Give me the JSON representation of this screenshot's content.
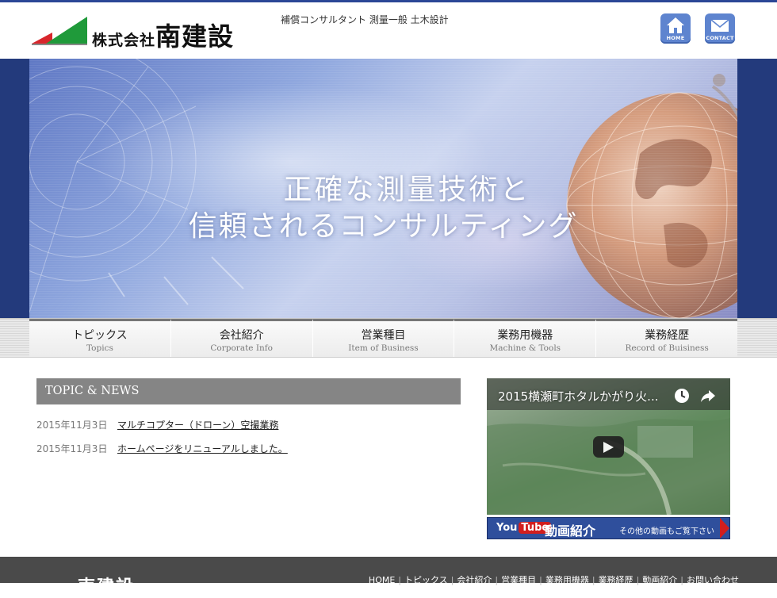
{
  "header": {
    "logo_small": "株式会社",
    "logo_big": "南建設",
    "tagline": "補償コンサルタント 測量一般 土木設計",
    "home_label": "HOME",
    "contact_label": "CONTACT"
  },
  "hero": {
    "line1": "正確な測量技術と",
    "line2": "信頼されるコンサルティング"
  },
  "nav": [
    {
      "jp": "トピックス",
      "en": "Topics"
    },
    {
      "jp": "会社紹介",
      "en": "Corporate Info"
    },
    {
      "jp": "営業種目",
      "en": "Item of Business"
    },
    {
      "jp": "業務用機器",
      "en": "Machine & Tools"
    },
    {
      "jp": "業務経歴",
      "en": "Record of Buisiness"
    }
  ],
  "topics": {
    "heading": "TOPIC & NEWS",
    "items": [
      {
        "date": "2015年11月3日",
        "title": "マルチコプター（ドローン）空撮業務"
      },
      {
        "date": "2015年11月3日",
        "title": "ホームページをリニューアルしました。"
      }
    ]
  },
  "video": {
    "title": "2015横瀬町ホタルかがり火...",
    "yt_you": "You",
    "yt_tube": "Tube",
    "label": "動画紹介",
    "sub": "その他の動画もご覧下さい"
  },
  "footer": {
    "logo": "南建設",
    "links": [
      "HOME",
      "トピックス",
      "会社紹介",
      "営業種目",
      "業務用機器",
      "業務経歴",
      "動画紹介",
      "お問い合わせ"
    ]
  },
  "colors": {
    "accent_blue": "#2b4796",
    "hero_band": "#233a7c",
    "logo_green": "#1f9a3a",
    "logo_red": "#d8262c",
    "topic_head_gray": "#858585",
    "footer_gray": "#4a4a4a"
  }
}
